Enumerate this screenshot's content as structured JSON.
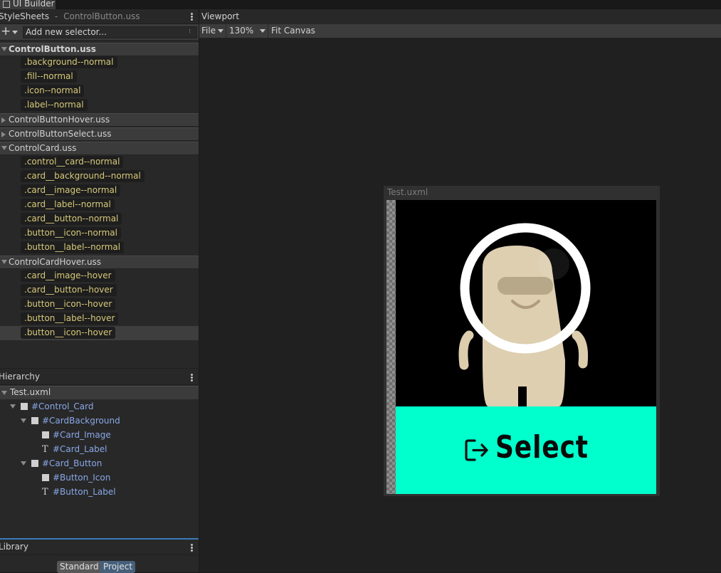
{
  "app": {
    "title": "UI Builder"
  },
  "stylesheets": {
    "header": "StyleSheets",
    "header_sep": "-",
    "header_file": "ControlButton.uss",
    "add_selector_placeholder": "Add new selector...",
    "add_dots": "⁝",
    "sheets": [
      {
        "name": "ControlButton.uss",
        "expanded": true,
        "selectors": [
          ".background--normal",
          ".fill--normal",
          ".icon--normal",
          ".label--normal"
        ]
      },
      {
        "name": "ControlButtonHover.uss",
        "expanded": false,
        "selectors": []
      },
      {
        "name": "ControlButtonSelect.uss",
        "expanded": false,
        "selectors": []
      },
      {
        "name": "ControlCard.uss",
        "expanded": true,
        "selectors": [
          ".control__card--normal",
          ".card__background--normal",
          ".card__image--normal",
          ".card__label--normal",
          ".card__button--normal",
          ".button__icon--normal",
          ".button__label--normal"
        ]
      },
      {
        "name": "ControlCardHover.uss",
        "expanded": true,
        "selectors": [
          ".card__image--hover",
          ".card__button--hover",
          ".button__icon--hover",
          ".button__label--hover",
          ".button__icon--hover"
        ]
      }
    ]
  },
  "hierarchy": {
    "header": "Hierarchy",
    "root": "Test.uxml",
    "items": [
      {
        "label": "#Control_Card",
        "type": "element"
      },
      {
        "label": "#CardBackground",
        "type": "element"
      },
      {
        "label": "#Card_Image",
        "type": "element"
      },
      {
        "label": "#Card_Label",
        "type": "text"
      },
      {
        "label": "#Card_Button",
        "type": "element"
      },
      {
        "label": "#Button_Icon",
        "type": "element"
      },
      {
        "label": "#Button_Label",
        "type": "text"
      }
    ]
  },
  "library": {
    "header": "Library",
    "tabs": [
      "Standard",
      "Project"
    ],
    "active_tab": "Project"
  },
  "viewport": {
    "header": "Viewport",
    "file_menu": "File",
    "zoom": "130%",
    "fit_canvas": "Fit Canvas",
    "document_title": "Test.uxml",
    "button_label": "Select"
  },
  "colors": {
    "accent_button": "#00ffcc",
    "selector_text": "#d7c97a",
    "hierarchy_text": "#88a7e8"
  }
}
